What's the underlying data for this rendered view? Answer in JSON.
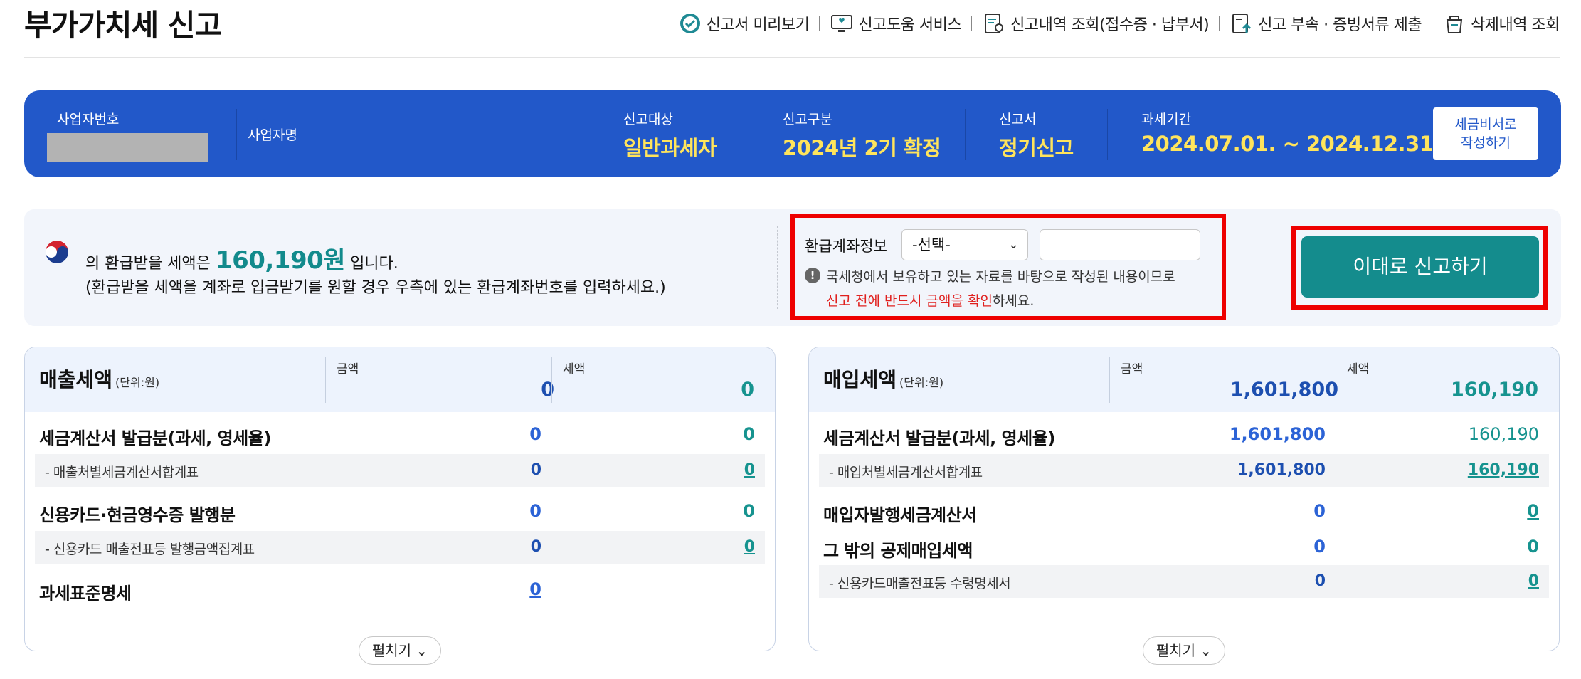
{
  "header": {
    "title": "부가가치세 신고",
    "links": [
      {
        "label": "신고서 미리보기",
        "icon": "check-circle-icon"
      },
      {
        "label": "신고도움 서비스",
        "icon": "monitor-heart-icon"
      },
      {
        "label": "신고내역 조회(접수증 · 납부서)",
        "icon": "document-search-icon"
      },
      {
        "label": "신고 부속 · 증빙서류 제출",
        "icon": "document-upload-icon"
      },
      {
        "label": "삭제내역 조회",
        "icon": "trash-basket-icon"
      }
    ]
  },
  "infobar": {
    "biz_no_label": "사업자번호",
    "biz_name_label": "사업자명",
    "target_label": "신고대상",
    "target_value": "일반과세자",
    "type_label": "신고구분",
    "type_value": "2024년 2기 확정",
    "form_label": "신고서",
    "form_value": "정기신고",
    "period_label": "과세기간",
    "period_value": "2024.07.01. ~ 2024.12.31.",
    "secretary_button": [
      "세금비서로",
      "작성하기"
    ]
  },
  "refund": {
    "prefix": "의 환급받을 세액은",
    "amount": "160,190원",
    "suffix": "입니다.",
    "line2": "(환급받을 세액을 계좌로 입금받기를 원할 경우 우측에 있는 환급계좌번호를 입력하세요.)",
    "account_label": "환급계좌정보",
    "account_select": "-선택-",
    "account_input_value": "",
    "notice_line1": "국세청에서 보유하고 있는 자료를 바탕으로 작성된 내용이므로",
    "notice_red": "신고 전에 반드시 금액을 확인",
    "notice_tail": "하세요.",
    "submit_label": "이대로 신고하기"
  },
  "sales": {
    "title": "매출세액",
    "unit": "(단위:원)",
    "amount_label": "금액",
    "tax_label": "세액",
    "total_amount": "0",
    "total_tax": "0",
    "rows": [
      {
        "label": "세금계산서 발급분(과세, 영세율)",
        "amount": "0",
        "tax": "0"
      },
      {
        "label": "- 매출처별세금계산서합계표",
        "amount": "0",
        "tax": "0"
      },
      {
        "label": "신용카드·현금영수증 발행분",
        "amount": "0",
        "tax": "0"
      },
      {
        "label": "- 신용카드 매출전표등 발행금액집계표",
        "amount": "0",
        "tax": "0"
      },
      {
        "label": "과세표준명세",
        "amount": "0"
      }
    ],
    "expand_label": "펼치기"
  },
  "purchase": {
    "title": "매입세액",
    "unit": "(단위:원)",
    "amount_label": "금액",
    "tax_label": "세액",
    "total_amount": "1,601,800",
    "total_tax": "160,190",
    "rows": [
      {
        "label": "세금계산서 발급분(과세, 영세율)",
        "amount": "1,601,800",
        "tax": "160,190"
      },
      {
        "label": "- 매입처별세금계산서합계표",
        "amount": "1,601,800",
        "tax": "160,190"
      },
      {
        "label": "매입자발행세금계산서",
        "amount": "0",
        "tax": "0"
      },
      {
        "label": "그 밖의 공제매입세액",
        "amount": "0",
        "tax": "0"
      },
      {
        "label": "- 신용카드매출전표등 수령명세서",
        "amount": "0",
        "tax": "0"
      }
    ],
    "expand_label": "펼치기"
  },
  "colors": {
    "primary_blue": "#2258c9",
    "highlight_yellow": "#ffe45c",
    "teal": "#148c8d",
    "alert_red": "#ee0000"
  }
}
